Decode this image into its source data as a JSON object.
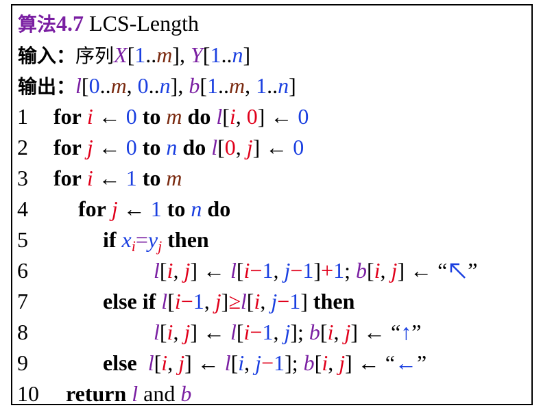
{
  "title": {
    "prefix": "算法",
    "number": "4.7",
    "name": " LCS-Length"
  },
  "input": {
    "label": "输入：",
    "text": "序列"
  },
  "output": {
    "label": "输出："
  },
  "lines": {
    "n1": "1",
    "n2": "2",
    "n3": "3",
    "n4": "4",
    "n5": "5",
    "n6": "6",
    "n7": "7",
    "n8": "8",
    "n9": "9",
    "n10": "10"
  },
  "keywords": {
    "for": "for",
    "to": "to",
    "do": "do",
    "if": "if",
    "then": "then",
    "else_if": "else if",
    "else": "else",
    "return": "return"
  },
  "colors": {
    "purple": "#7a1fa2",
    "red": "#e0001b",
    "blue": "#1a3fe0",
    "brown": "#7a2a10"
  }
}
